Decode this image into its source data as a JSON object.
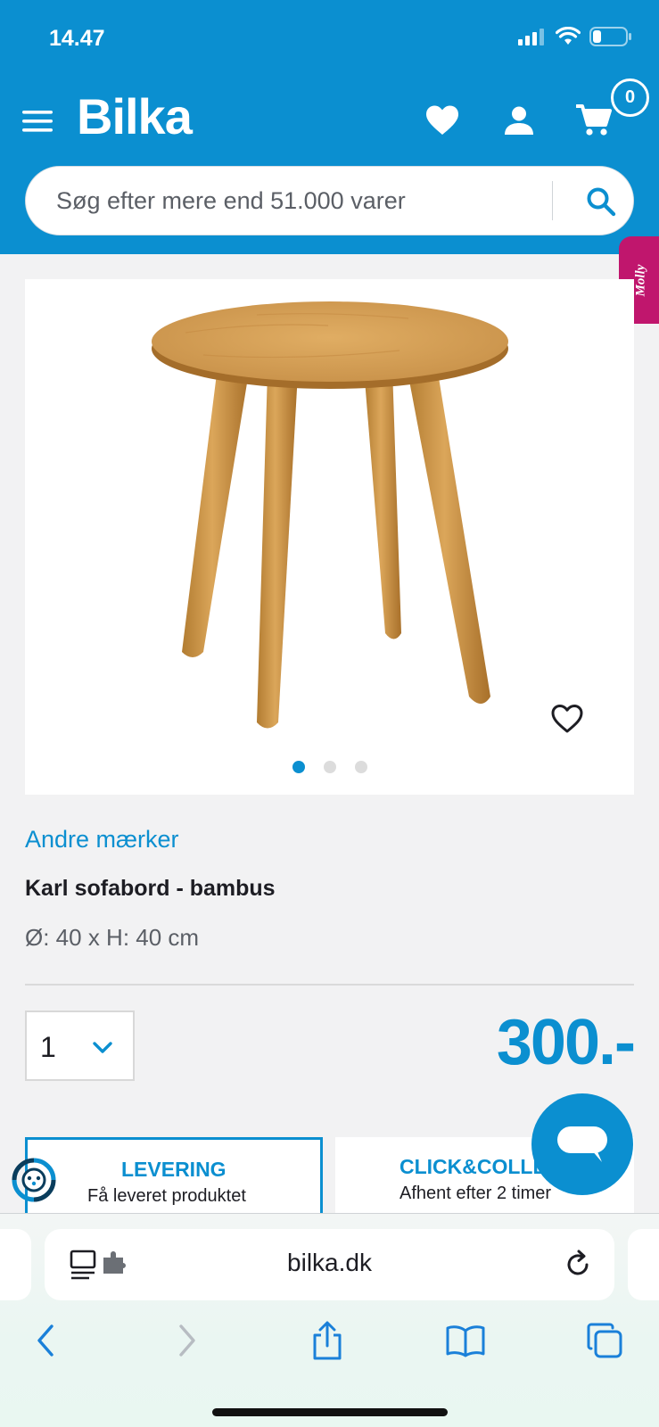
{
  "status_bar": {
    "time": "14.47"
  },
  "header": {
    "logo": "Bilka",
    "cart_count": "0"
  },
  "search": {
    "placeholder": "Søg efter mere end 51.000 varer"
  },
  "molly": {
    "label": "Molly"
  },
  "product": {
    "image_count": 3,
    "active_image": 1,
    "brand": "Andre mærker",
    "title": "Karl sofabord - bambus",
    "subtitle": "Ø: 40 x H: 40 cm",
    "quantity": "1",
    "price": "300.-"
  },
  "delivery": {
    "levering_title": "LEVERING",
    "levering_sub": "Få leveret produktet",
    "click_title": "CLICK&COLLECT",
    "click_sub": "Afhent efter 2 timer"
  },
  "browser": {
    "url": "bilka.dk"
  },
  "colors": {
    "brand_blue": "#0b8fd0",
    "molly_pink": "#c0166d"
  },
  "icons": [
    "menu-icon",
    "heart-icon",
    "user-icon",
    "cart-icon",
    "search-icon",
    "chevron-down-icon",
    "chat-icon",
    "delivery-icon",
    "reader-icon",
    "reload-icon",
    "back-icon",
    "forward-icon",
    "share-icon",
    "bookmarks-icon",
    "tabs-icon"
  ]
}
